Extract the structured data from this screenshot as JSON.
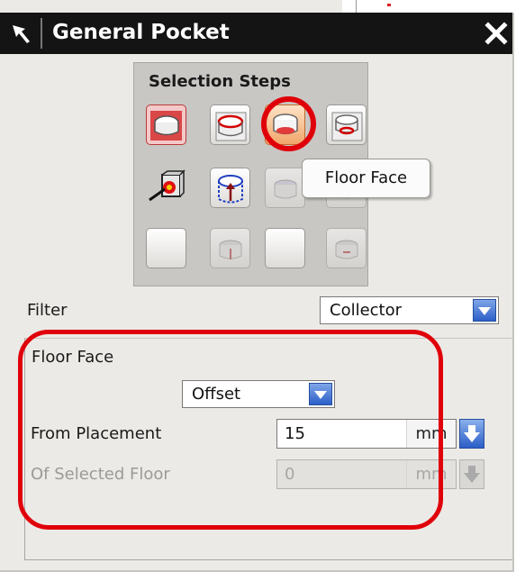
{
  "dialog": {
    "title": "General Pocket",
    "pin_icon": "pin-arrow-icon",
    "close_icon": "close-icon"
  },
  "selection_steps": {
    "heading": "Selection Steps",
    "active_index": 2,
    "steps": [
      {
        "name": "placement-face",
        "icon": "placement-face-icon",
        "state": "done"
      },
      {
        "name": "pocket-outline",
        "icon": "pocket-outline-icon",
        "state": "normal"
      },
      {
        "name": "floor-face",
        "icon": "floor-face-icon",
        "state": "active"
      },
      {
        "name": "floor-outline",
        "icon": "floor-outline-icon",
        "state": "normal"
      },
      {
        "name": "target-body",
        "icon": "target-body-icon",
        "state": "normal"
      },
      {
        "name": "placement-outline-projection",
        "icon": "projection-vector-icon",
        "state": "normal"
      },
      {
        "name": "step-7",
        "icon": "pocket-step-icon",
        "state": "dim"
      },
      {
        "name": "step-8",
        "icon": "pocket-step-icon",
        "state": "dim"
      },
      {
        "name": "step-9",
        "icon": "blank-step-icon",
        "state": "normal"
      },
      {
        "name": "step-10",
        "icon": "pocket-step-icon",
        "state": "dim"
      },
      {
        "name": "step-11",
        "icon": "blank-step-icon",
        "state": "normal"
      },
      {
        "name": "step-12",
        "icon": "pocket-step-icon",
        "state": "dim"
      }
    ]
  },
  "tooltip": {
    "text": "Floor Face"
  },
  "filter": {
    "label": "Filter",
    "value": "Collector"
  },
  "floor_face": {
    "heading": "Floor Face",
    "mode": "Offset",
    "from_placement": {
      "label": "From Placement",
      "value": "15",
      "unit": "mm",
      "enabled": true
    },
    "of_selected_floor": {
      "label": "Of Selected Floor",
      "value": "0",
      "unit": "mm",
      "enabled": false
    }
  },
  "annotations": {
    "highlight_color": "#e0000a"
  },
  "colors": {
    "title_bar": "#141414",
    "panel": "#eceae6",
    "accent_blue": "#2c5fc8"
  }
}
